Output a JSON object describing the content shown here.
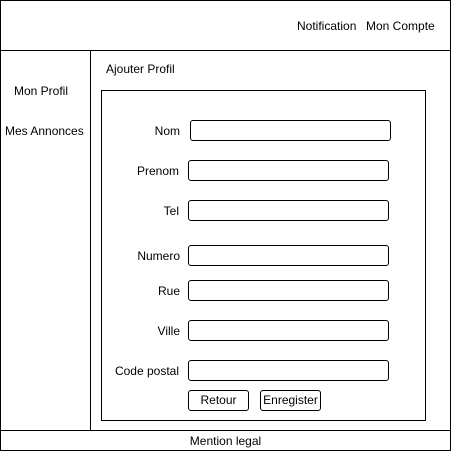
{
  "header": {
    "notification": "Notification",
    "account": "Mon Compte"
  },
  "sidebar": {
    "items": [
      {
        "label": "Mon Profil"
      },
      {
        "label": "Mes Annonces"
      }
    ]
  },
  "main": {
    "title": "Ajouter Profil",
    "fields": [
      {
        "label": "Nom",
        "value": ""
      },
      {
        "label": "Prenom",
        "value": ""
      },
      {
        "label": "Tel",
        "value": ""
      },
      {
        "label": "Numero",
        "value": ""
      },
      {
        "label": "Rue",
        "value": ""
      },
      {
        "label": "Ville",
        "value": ""
      },
      {
        "label": "Code postal",
        "value": ""
      }
    ],
    "back_label": "Retour",
    "save_label": "Enregister"
  },
  "footer": {
    "text": "Mention legal"
  }
}
